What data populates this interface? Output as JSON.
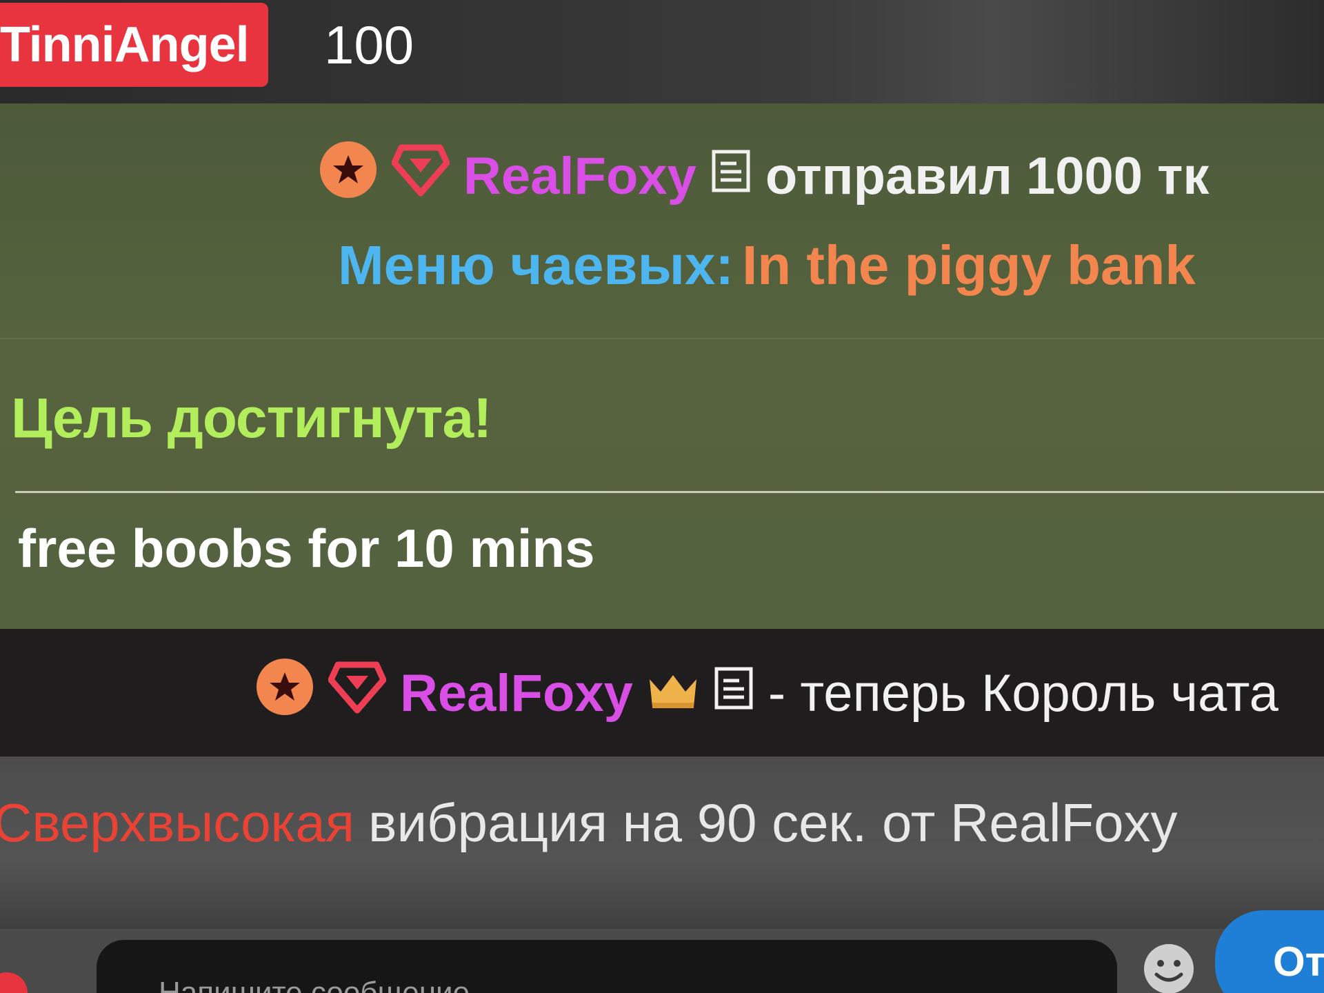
{
  "top_user": {
    "name": "TinniAngel",
    "amount": "100"
  },
  "tip_message": {
    "username": "RealFoxy",
    "action": "отправил",
    "amount": "1000 тк",
    "menu_label": "Меню чаевых:",
    "menu_item": "In the piggy bank"
  },
  "goal": {
    "status": "Цель достигнута!",
    "description": "free boobs for 10 mins"
  },
  "king_message": {
    "username": "RealFoxy",
    "text": "- теперь Король чата"
  },
  "vibration_message": {
    "level": "Сверхвысокая",
    "text": "вибрация на 90 сек. от RealFoxy"
  },
  "composer": {
    "placeholder": "Напишите сообщение...",
    "send_label": "Отправить"
  },
  "icons": {
    "badge": "star-badge-icon",
    "diamond": "diamond-icon",
    "notes": "notes-icon",
    "crown": "crown-icon",
    "emoji": "emoji-icon"
  },
  "colors": {
    "username_magenta": "#d94fe6",
    "menu_blue": "#4db5ef",
    "menu_item_orange": "#f2864e",
    "goal_green": "#b2ee5c",
    "vibration_red": "#ea4335",
    "user_chip_red": "#e8343f",
    "send_blue": "#1f7fd6"
  }
}
